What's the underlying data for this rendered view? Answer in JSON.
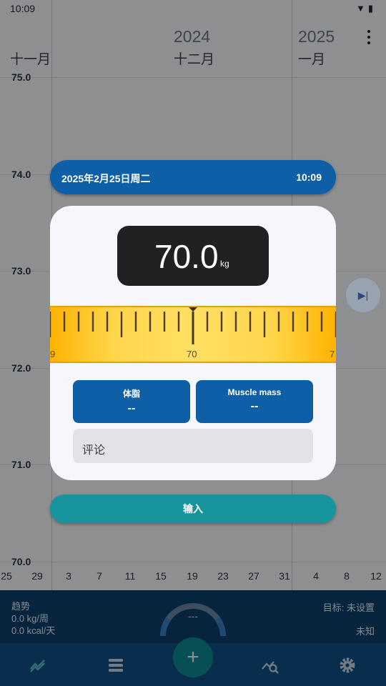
{
  "status_bar": {
    "time": "10:09",
    "icons": [
      "wifi-icon",
      "battery-icon"
    ]
  },
  "chart": {
    "y_ticks": [
      "75.0",
      "74.0",
      "73.0",
      "72.0",
      "71.0",
      "70.0"
    ],
    "x_ticks": [
      "25",
      "29",
      "3",
      "7",
      "11",
      "15",
      "19",
      "23",
      "27",
      "31",
      "4",
      "8",
      "12"
    ],
    "months": [
      {
        "year": "",
        "month": "十一月"
      },
      {
        "year": "2024",
        "month": "十二月"
      },
      {
        "year": "2025",
        "month": "一月"
      }
    ]
  },
  "dialog": {
    "date": "2025年2月25日周二",
    "time": "10:09",
    "weight": "70.0",
    "unit": "kg",
    "ruler": {
      "center_label": "70",
      "left_label": "9",
      "right_label": "7"
    },
    "body_fat": {
      "label": "体脂",
      "value": "--"
    },
    "muscle_mass": {
      "label": "Muscle mass",
      "value": "--"
    },
    "comment_placeholder": "评论",
    "enter_label": "输入"
  },
  "summary": {
    "trend_label": "趋势",
    "trend_weight": "0.0 kg/周",
    "trend_energy": "0.0 kcal/天",
    "gauge_value": "---",
    "goal_label": "目标: 未设置",
    "goal_status": "未知"
  },
  "nav": {
    "items": [
      "chart-icon",
      "list-icon",
      "add-icon",
      "analysis-icon",
      "settings-icon"
    ],
    "fab_symbol": "+"
  },
  "colors": {
    "primary": "#0f5fa6",
    "accent": "#17949c",
    "ruler": "#ffd54a",
    "summary_bg": "#0b3f6b"
  }
}
